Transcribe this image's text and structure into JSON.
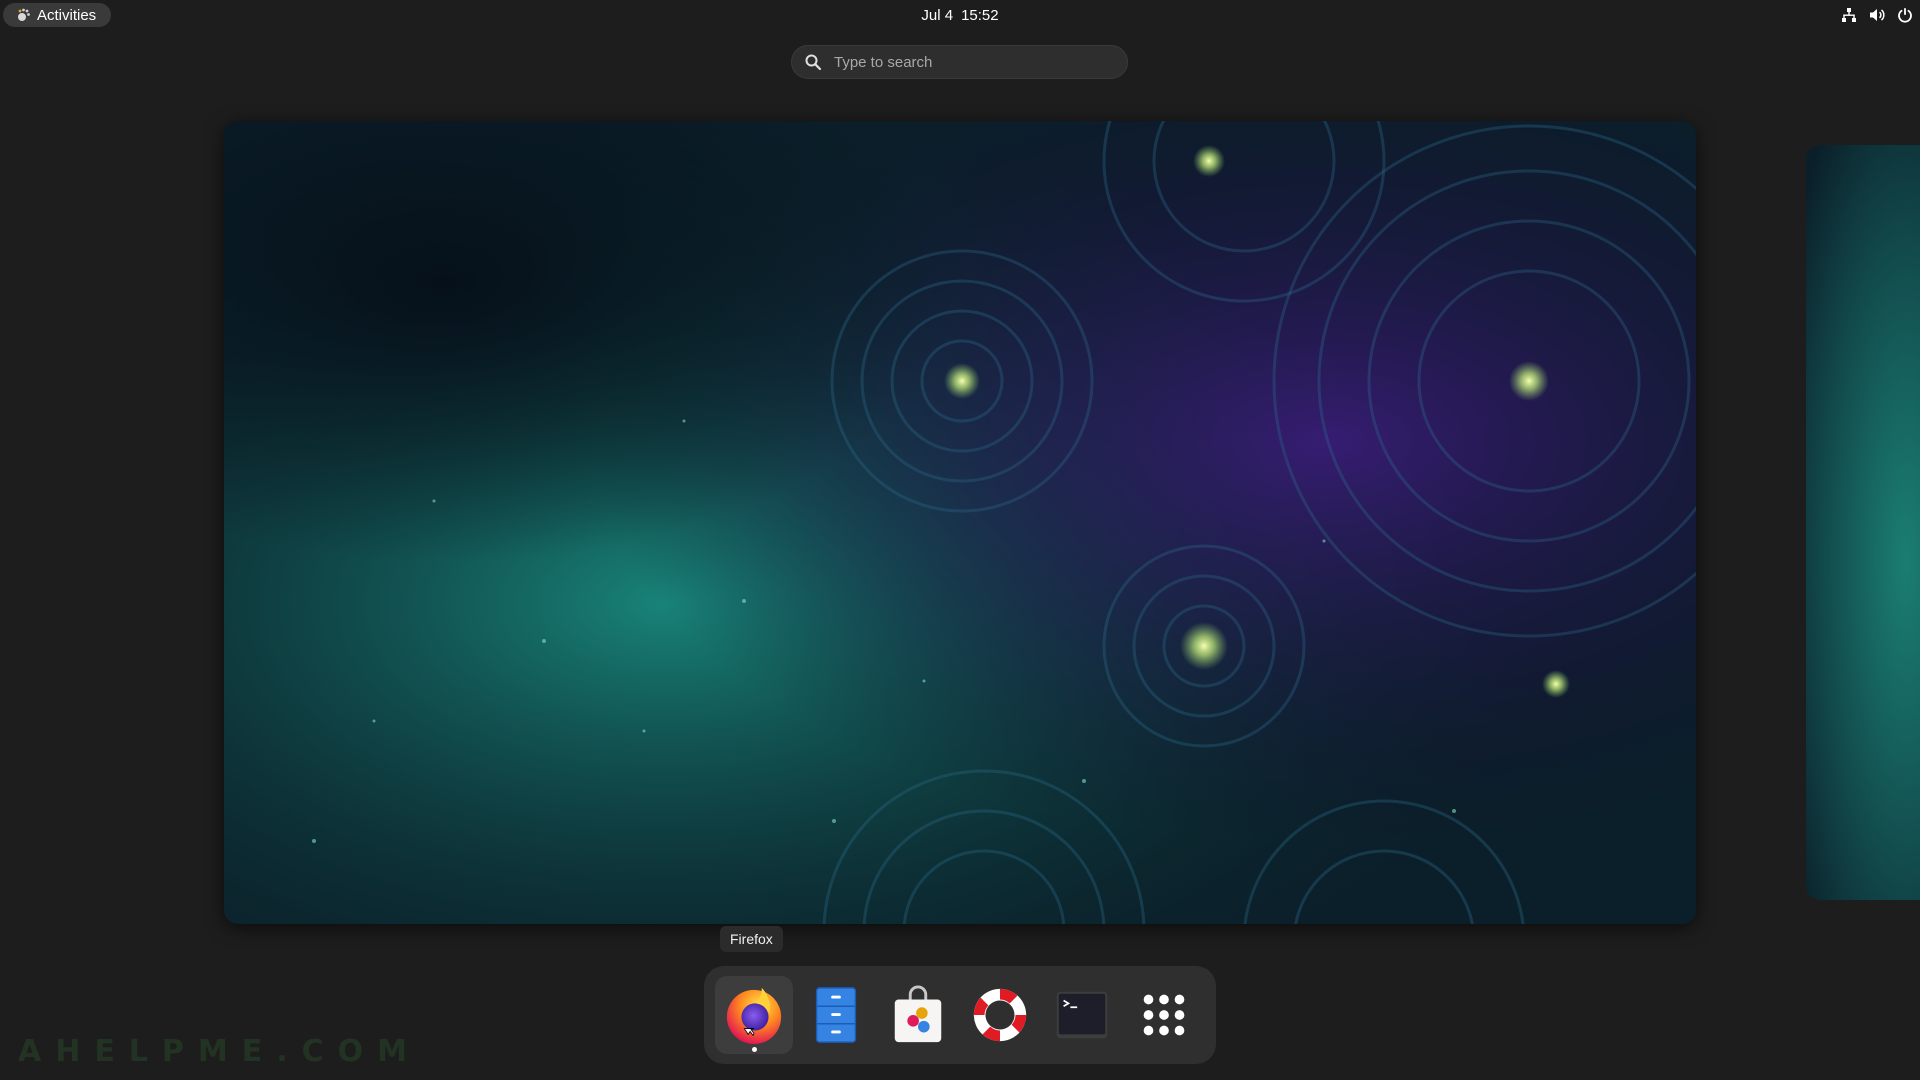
{
  "topbar": {
    "activities_label": "Activities",
    "date": "Jul 4",
    "time": "15:52",
    "tray_icons": [
      "network-icon",
      "volume-icon",
      "power-icon"
    ]
  },
  "search": {
    "placeholder": "Type to search",
    "value": ""
  },
  "dash": {
    "tooltip": "Firefox",
    "apps": [
      {
        "name": "Firefox",
        "icon": "firefox-icon",
        "running": true
      },
      {
        "name": "Files",
        "icon": "files-icon",
        "running": false
      },
      {
        "name": "Software",
        "icon": "software-icon",
        "running": false
      },
      {
        "name": "Help",
        "icon": "help-icon",
        "running": false
      },
      {
        "name": "Terminal",
        "icon": "terminal-icon",
        "running": false
      },
      {
        "name": "Show Applications",
        "icon": "app-grid-icon",
        "running": false
      }
    ]
  },
  "watermark": "AHELPME.COM",
  "colors": {
    "panel": "#1d1d1d",
    "dash": "#2f2f2f",
    "search": "#2e2e2e",
    "wallpaper_teal": "#1a8f82",
    "wallpaper_purple": "#3b1c7a"
  }
}
